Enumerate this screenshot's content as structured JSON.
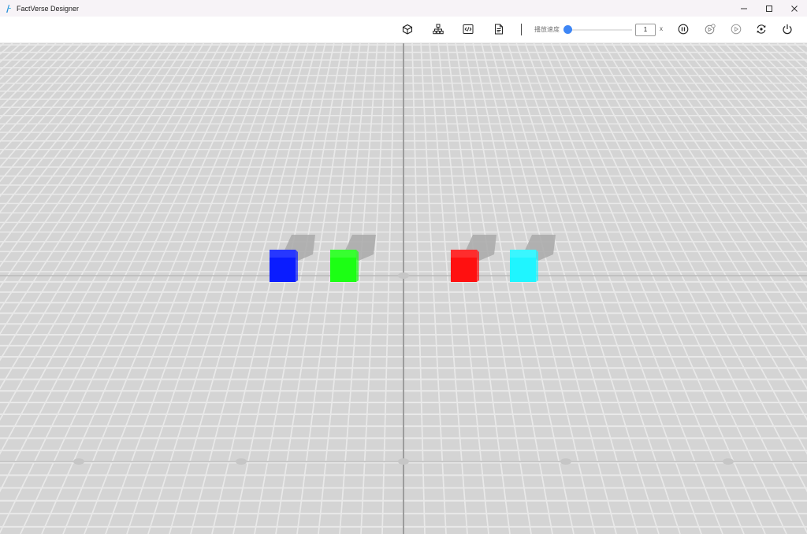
{
  "window": {
    "title": "FactVerse Designer",
    "controls": [
      "minimize-icon",
      "maximize-icon",
      "close-icon"
    ]
  },
  "toolbar": {
    "icons": [
      "cube-icon",
      "hierarchy-icon",
      "code-icon",
      "document-icon"
    ],
    "speed_label": "播放速度",
    "speed_value": "1",
    "speed_unit": "x",
    "speed_slider_level": 0,
    "playback_icons": [
      "pause-icon",
      "record-icon",
      "play-icon",
      "reset-icon",
      "power-icon"
    ]
  },
  "scene": {
    "cubes": [
      {
        "name": "blue-cube",
        "color": "#0a1cff"
      },
      {
        "name": "green-cube",
        "color": "#1cff14"
      },
      {
        "name": "red-cube",
        "color": "#ff1010"
      },
      {
        "name": "cyan-cube",
        "color": "#1ff5ff"
      }
    ],
    "ground_color": "#d4d4d4",
    "grid_color": "#e9e9e9",
    "axis_color": "#9c9c9c"
  }
}
